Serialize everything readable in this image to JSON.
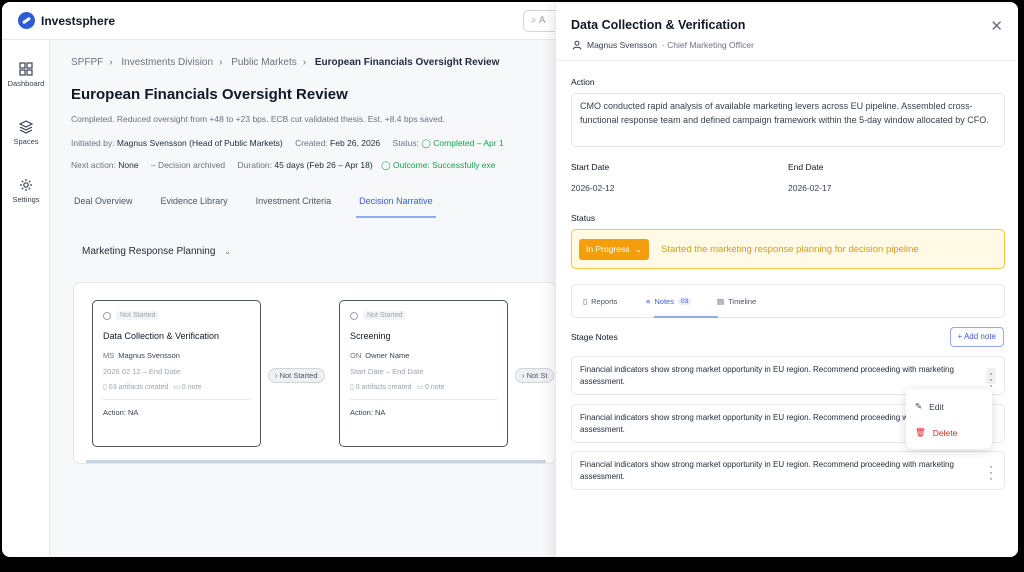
{
  "app": {
    "name": "Investsphere",
    "search_placeholder": "A"
  },
  "rail": [
    {
      "label": "Dashboard",
      "icon": "grid-icon"
    },
    {
      "label": "Spaces",
      "icon": "layers-icon"
    },
    {
      "label": "Settings",
      "icon": "gear-icon"
    }
  ],
  "breadcrumb": [
    "SPFPF",
    "Investments Division",
    "Public Markets",
    "European Financials Oversight Review"
  ],
  "page": {
    "title": "European Financials Oversight Review",
    "summary": "Completed. Reduced oversight from +48 to +23 bps. ECB cut validated thesis. Est. +8.4 bps saved.",
    "initiated_label": "Initiated by:",
    "initiated_value": "Magnus Svensson (Head of Public Markets)",
    "created_label": "Created:",
    "created_value": "Feb 26, 2026",
    "status_label": "Status:",
    "status_value": "Completed – Apr 1",
    "next_label": "Next action:",
    "next_value": "None",
    "archived": "–  Decision archived",
    "duration_label": "Duration:",
    "duration_value": "45 days (Feb 26 – Apr 18)",
    "outcome": "Outcome: Successfully exe"
  },
  "tabs": [
    "Deal Overview",
    "Evidence Library",
    "Investment Criteria",
    "Decision Narrative"
  ],
  "stage_select": "Marketing Response Planning",
  "flow": {
    "cards": [
      {
        "status": "Not Started",
        "title": "Data Collection & Verification",
        "initials": "MS",
        "owner": "Magnus Svensson",
        "dates": "2026  02  12   –  End Date",
        "artifacts": "03 artifacts created",
        "notes": "0 note",
        "action": "Action: NA"
      },
      {
        "status": "Not Started",
        "title": "Screening",
        "initials": "ON",
        "owner": "Owner Name",
        "dates": "Start Date  –  End Date",
        "artifacts": "0 artifacts created",
        "notes": "0 note",
        "action": "Action: NA"
      }
    ],
    "connectors": [
      "Not Started",
      "Not St"
    ]
  },
  "drawer": {
    "title": "Data Collection & Verification",
    "user": "Magnus Svensson",
    "role": "· Chief Marketing Officer",
    "action_label": "Action",
    "action_text": "CMO conducted rapid analysis of available marketing levers across EU pipeline. Assembled cross-functional response team and defined campaign framework within the 5-day window allocated by CFO.",
    "start_label": "Start Date",
    "start_value": "2026-02-12",
    "end_label": "End Date",
    "end_value": "2026-02-17",
    "status_label": "Status",
    "status_button": "In Progress",
    "status_text": "Started the marketing response planning for decision pipeline",
    "tabs": {
      "reports": "Reports",
      "notes": "Notes",
      "notes_count": "03",
      "timeline": "Timeline"
    },
    "stage_notes_label": "Stage Notes",
    "add_note": "Add note",
    "notes": [
      "Financial indicators show strong market opportunity in EU region. Recommend proceeding with marketing assessment.",
      "Financial indicators show strong market opportunity in EU region. Recommend proceeding with marketing assessment.",
      "Financial indicators show strong market opportunity in EU region. Recommend proceeding with marketing assessment."
    ],
    "menu": {
      "edit": "Edit",
      "delete": "Delete"
    }
  },
  "colors": {
    "accent": "#3b5bdb",
    "success": "#16a34a",
    "warning": "#f59e0b",
    "danger": "#dc2626"
  }
}
